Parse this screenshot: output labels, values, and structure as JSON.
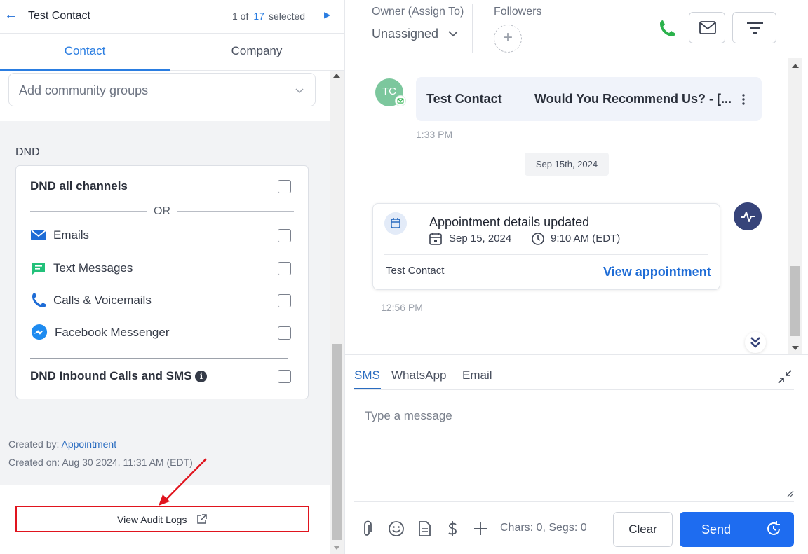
{
  "header": {
    "back_icon": "arrow-left-icon",
    "contact_name": "Test Contact",
    "pager_prefix": "1 of",
    "pager_total": "17",
    "pager_suffix": "selected",
    "next_icon": "caret-right-icon"
  },
  "tabs": [
    {
      "label": "Contact",
      "active": true
    },
    {
      "label": "Company",
      "active": false
    }
  ],
  "community_groups": {
    "placeholder": "Add community groups",
    "icon": "chevron-down-icon"
  },
  "dnd": {
    "section_label": "DND",
    "all_channels": {
      "label": "DND all channels",
      "checked": false
    },
    "or_text": "OR",
    "channels": [
      {
        "label": "Emails",
        "icon": "mail-icon",
        "checked": false
      },
      {
        "label": "Text Messages",
        "icon": "chat-icon",
        "checked": false
      },
      {
        "label": "Calls & Voicemails",
        "icon": "phone-icon",
        "checked": false
      },
      {
        "label": "Facebook Messenger",
        "icon": "messenger-icon",
        "checked": false
      }
    ],
    "inbound": {
      "label": "DND Inbound Calls and SMS",
      "checked": false,
      "icon": "info-icon"
    }
  },
  "meta": {
    "created_by_label": "Created by:",
    "created_by_value": "Appointment",
    "created_on": "Created on: Aug 30 2024, 11:31 AM (EDT)"
  },
  "audit": {
    "label": "View Audit Logs",
    "icon": "external-link-icon"
  },
  "topbar": {
    "owner_label": "Owner (Assign To)",
    "owner_value": "Unassigned",
    "followers_label": "Followers",
    "followers_add": "+",
    "icons": [
      "phone-icon",
      "mail-icon",
      "filter-icon"
    ]
  },
  "conversation": {
    "avatar_initials": "TC",
    "message": {
      "sender": "Test Contact",
      "subject": "Would You Recommend Us?  -  [...",
      "time": "1:33 PM"
    },
    "date_chip": "Sep 15th, 2024",
    "appointment": {
      "title": "Appointment details updated",
      "date": "Sep 15, 2024",
      "time": "9:10 AM (EDT)",
      "contact": "Test Contact",
      "action": "View appointment",
      "timestamp": "12:56 PM"
    }
  },
  "composer": {
    "tabs": [
      "SMS",
      "WhatsApp",
      "Email"
    ],
    "active_tab": "SMS",
    "placeholder": "Type a message",
    "counter": "Chars: 0, Segs: 0",
    "clear_label": "Clear",
    "send_label": "Send",
    "tools": [
      "paperclip-icon",
      "emoji-icon",
      "template-icon",
      "dollar-icon",
      "plus-icon"
    ]
  },
  "colors": {
    "accent": "#2a7de1",
    "send": "#1e6cf0",
    "highlight": "#e0141e",
    "success": "#2bb24c"
  }
}
